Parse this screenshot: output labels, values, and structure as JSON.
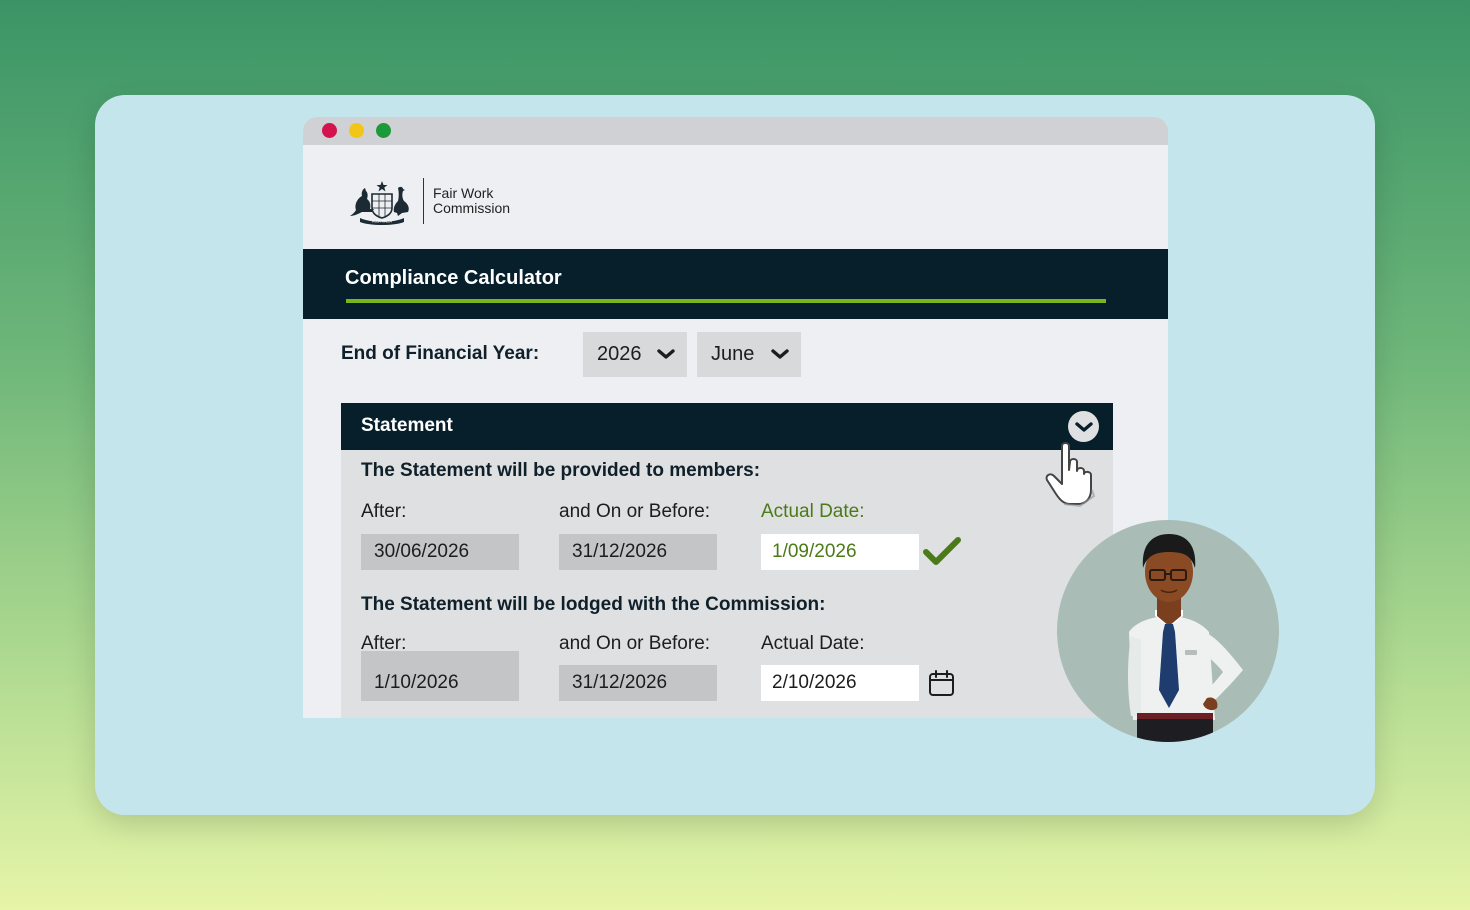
{
  "window": {
    "controls": [
      "close",
      "minimize",
      "maximize"
    ],
    "logo": {
      "text_line1": "Fair Work",
      "text_line2": "Commission",
      "crest_text": "AUSTRALIA"
    }
  },
  "app": {
    "title": "Compliance Calculator",
    "accent_color": "#7ab51d",
    "header_color": "#071f2b"
  },
  "eofy": {
    "label": "End of Financial Year:",
    "year": "2026",
    "month": "June"
  },
  "statement": {
    "title": "Statement",
    "members": {
      "heading": "The Statement will be provided to members:",
      "after_label": "After:",
      "after_value": "30/06/2026",
      "before_label": "and On or Before:",
      "before_value": "31/12/2026",
      "actual_label": "Actual Date:",
      "actual_value": "1/09/2026",
      "status_icon": "checkmark-icon"
    },
    "commission": {
      "heading": "The Statement will be lodged with the Commission:",
      "after_label": "After:",
      "after_value": "1/10/2026",
      "before_label": "and On or Before:",
      "before_value": "31/12/2026",
      "actual_label": "Actual Date:",
      "actual_value": "2/10/2026",
      "picker_icon": "calendar-icon"
    }
  },
  "overlay": {
    "cursor_icon": "hand-pointer-icon",
    "avatar": "presenter-avatar"
  }
}
